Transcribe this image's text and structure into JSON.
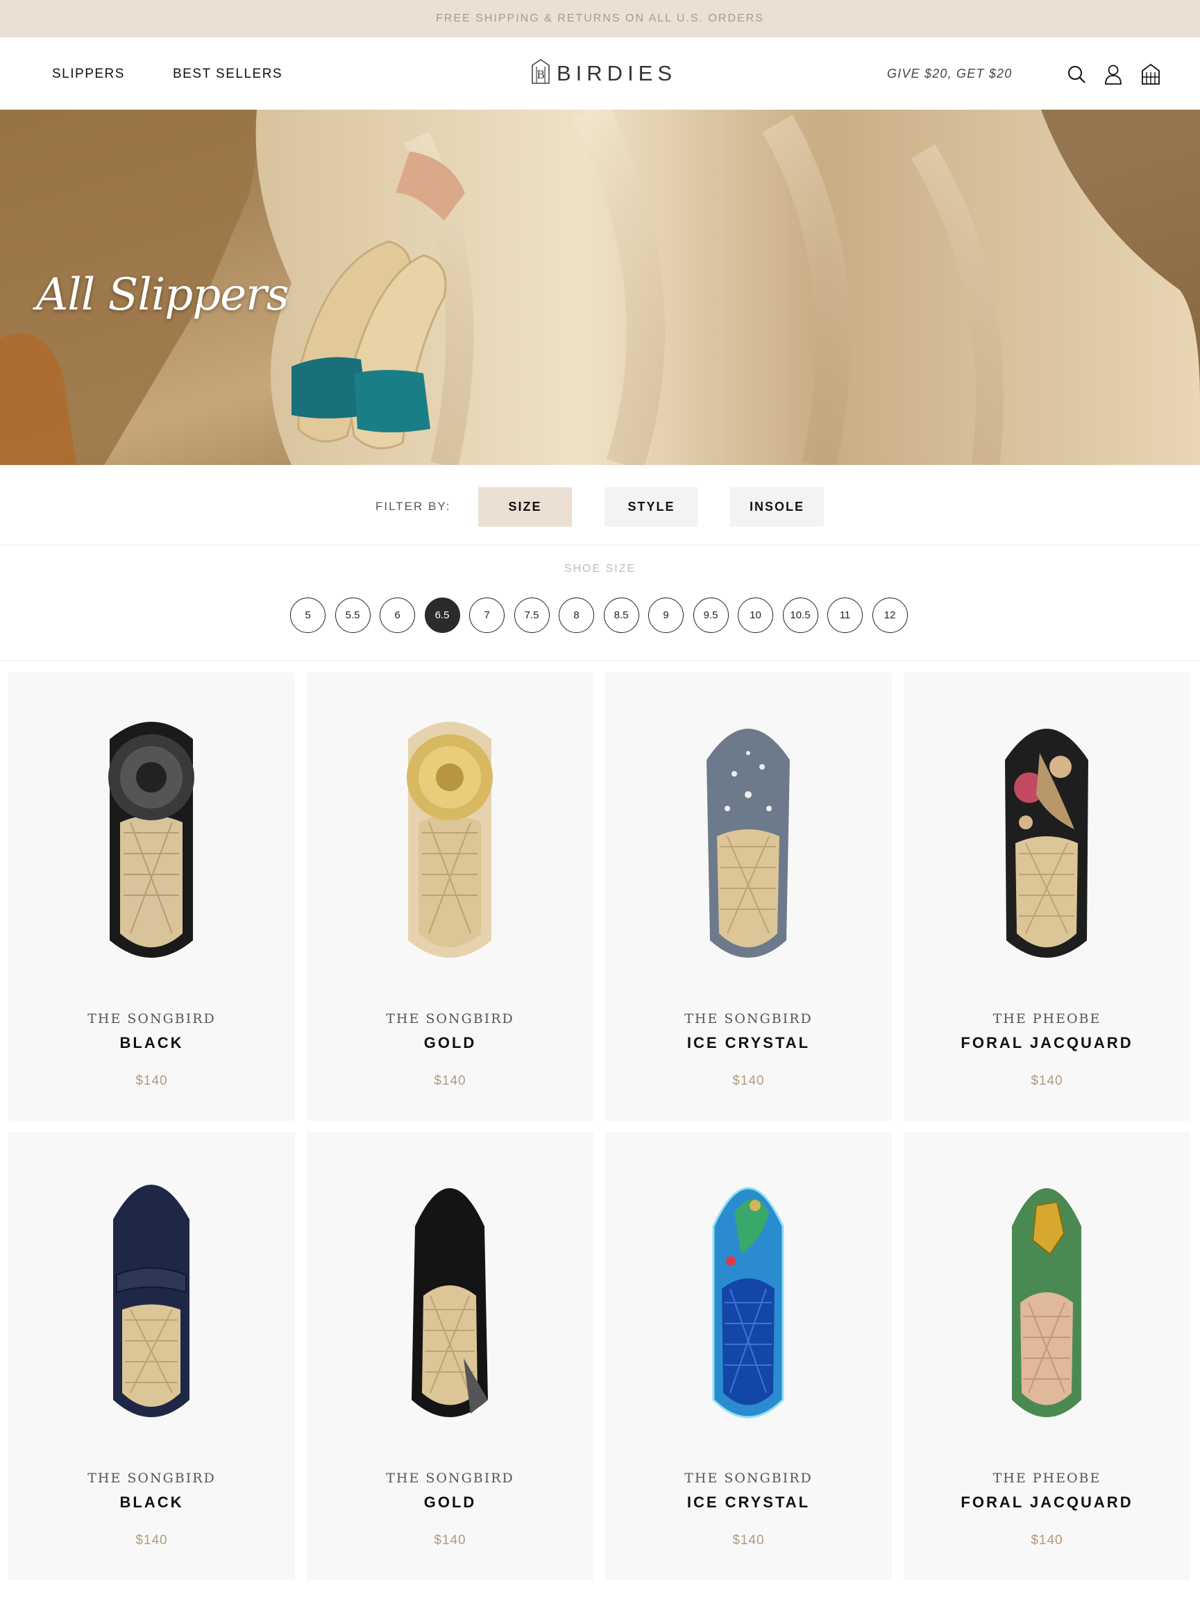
{
  "promo": {
    "text": "FREE SHIPPING & RETURNS ON ALL U.S. ORDERS"
  },
  "header": {
    "nav": [
      "SLIPPERS",
      "BEST SELLERS"
    ],
    "logo": "BIRDIES",
    "referral": "GIVE $20, GET $20",
    "icons": [
      "search-icon",
      "account-icon",
      "cart-icon"
    ]
  },
  "hero": {
    "title": "All Slippers"
  },
  "filters": {
    "label": "FILTER BY:",
    "buttons": [
      "SIZE",
      "STYLE",
      "INSOLE"
    ],
    "active": "SIZE"
  },
  "size_panel": {
    "heading": "SHOE SIZE",
    "sizes": [
      "5",
      "5.5",
      "6",
      "6.5",
      "7",
      "7.5",
      "8",
      "8.5",
      "9",
      "9.5",
      "10",
      "10.5",
      "11",
      "12"
    ],
    "selected": "6.5"
  },
  "products": [
    {
      "line1": "THE SONGBIRD",
      "line2": "BLACK",
      "price": "$140"
    },
    {
      "line1": "THE SONGBIRD",
      "line2": "GOLD",
      "price": "$140"
    },
    {
      "line1": "THE SONGBIRD",
      "line2": "ICE CRYSTAL",
      "price": "$140"
    },
    {
      "line1": "THE PHEOBE",
      "line2": "FORAL JACQUARD",
      "price": "$140"
    },
    {
      "line1": "THE SONGBIRD",
      "line2": "BLACK",
      "price": "$140"
    },
    {
      "line1": "THE SONGBIRD",
      "line2": "GOLD",
      "price": "$140"
    },
    {
      "line1": "THE SONGBIRD",
      "line2": "ICE CRYSTAL",
      "price": "$140"
    },
    {
      "line1": "THE PHEOBE",
      "line2": "FORAL JACQUARD",
      "price": "$140"
    }
  ],
  "colors": {
    "promo_bg": "#ecdfd3",
    "active_filter": "#ecdfd3",
    "price": "#b39a82",
    "selected_size": "#2b2b2b"
  }
}
